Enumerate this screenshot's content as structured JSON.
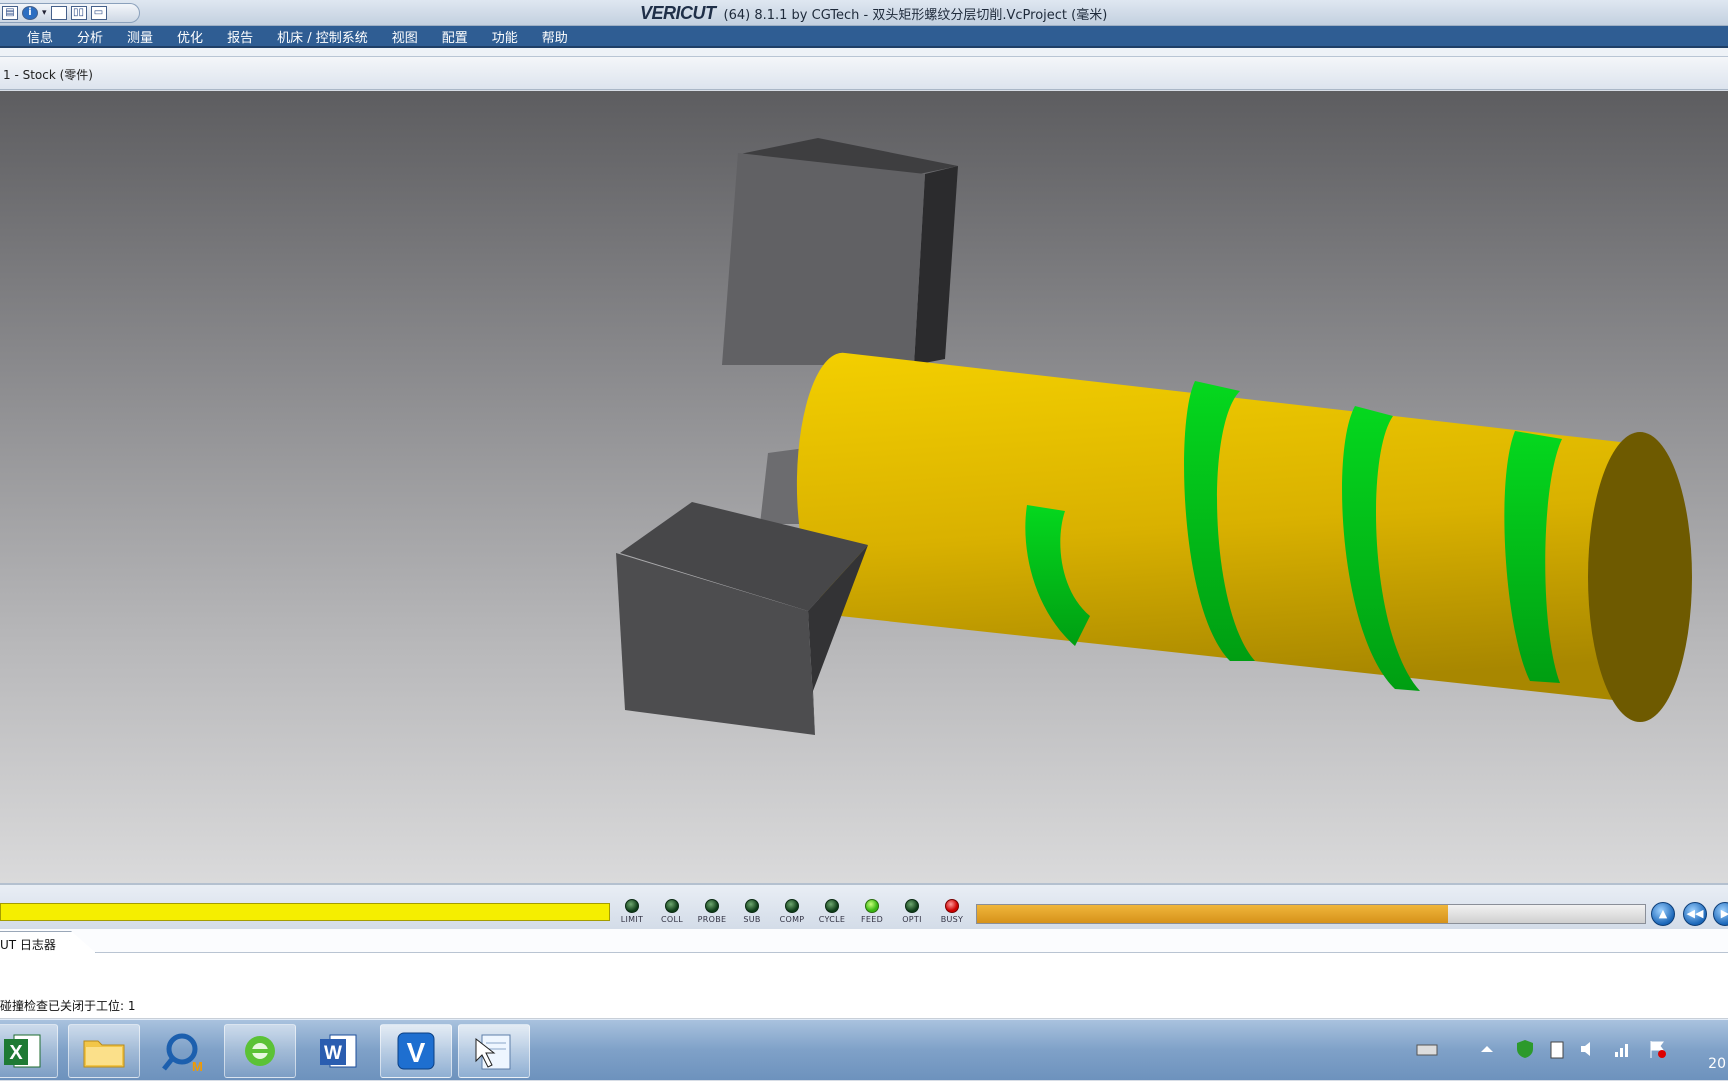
{
  "window": {
    "brand": "VERICUT",
    "title_rest": "(64)  8.1.1 by CGTech - 双头矩形螺纹分层切削.VcProject (毫米)"
  },
  "quick_access": {
    "info_icon": "info-icon"
  },
  "menu": [
    "信息",
    "分析",
    "测量",
    "优化",
    "报告",
    "机床 / 控制系统",
    "视图",
    "配置",
    "功能",
    "帮助"
  ],
  "view": {
    "label": "1 - Stock (零件)"
  },
  "colors": {
    "stock": "#e8c200",
    "cut": "#00d21a",
    "fixture": "#5c5c5f",
    "progress": "#e7a42a"
  },
  "status": {
    "leds": [
      {
        "label": "LIMIT",
        "state": "off"
      },
      {
        "label": "COLL",
        "state": "off"
      },
      {
        "label": "PROBE",
        "state": "off"
      },
      {
        "label": "SUB",
        "state": "off"
      },
      {
        "label": "COMP",
        "state": "off"
      },
      {
        "label": "CYCLE",
        "state": "off"
      },
      {
        "label": "FEED",
        "state": "on"
      },
      {
        "label": "OPTI",
        "state": "off"
      },
      {
        "label": "BUSY",
        "state": "red"
      }
    ],
    "progress_fraction": 0.705
  },
  "log": {
    "tab_label": "UT 日志器",
    "line": "碰撞检查已关闭于工位:  1"
  },
  "taskbar": {
    "apps": [
      "excel-icon",
      "file-explorer-icon",
      "mastercam-icon",
      "internet-explorer-icon",
      "word-icon",
      "vericut-icon",
      "notepad-icon"
    ],
    "clock": "20"
  }
}
